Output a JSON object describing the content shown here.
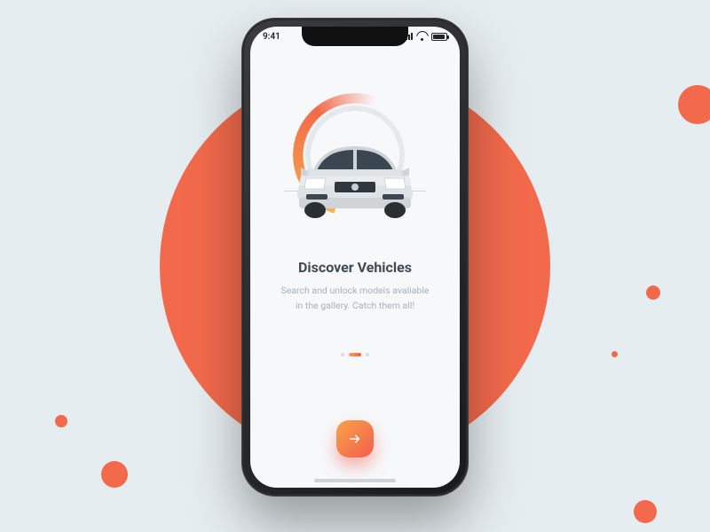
{
  "statusbar": {
    "time": "9:41"
  },
  "hero": {
    "ring_accent": "#f26a4b"
  },
  "content": {
    "title": "Discover Vehicles",
    "subtitle": "Search and unlock models avaliable in the gallery. Catch them all!"
  },
  "pager": {
    "current": 2,
    "total": 3
  },
  "actions": {
    "next_label": "Next"
  }
}
